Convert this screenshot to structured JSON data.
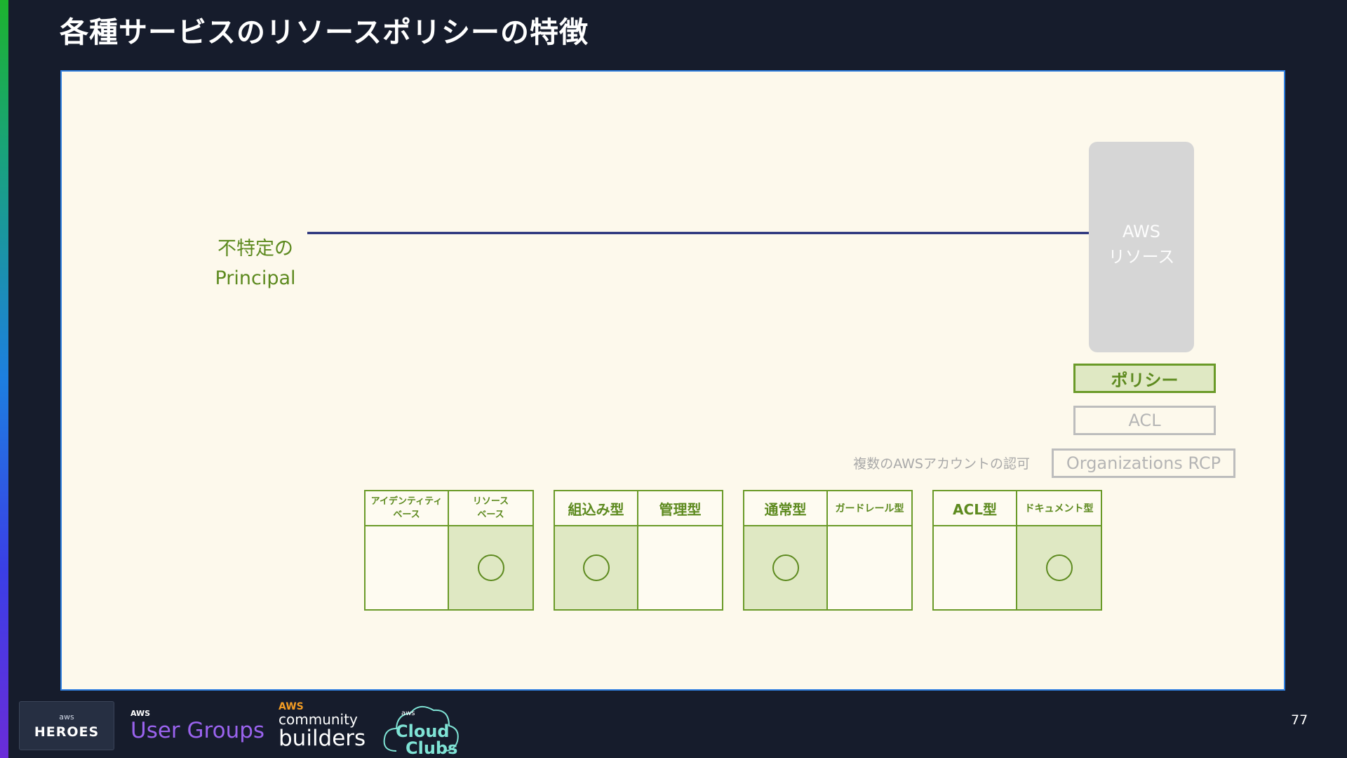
{
  "slide": {
    "title": "各種サービスのリソースポリシーの特徴",
    "page_number": "77"
  },
  "diagram": {
    "principal_line1": "不特定の",
    "principal_line2": "Principal",
    "resource_line1": "AWS",
    "resource_line2": "リソース",
    "policy_label": "ポリシー",
    "acl_label": "ACL",
    "rcp_label": "Organizations RCP",
    "rcp_note": "複数のAWSアカウントの認可"
  },
  "tables": [
    {
      "col1": "アイデンティティ\nベース",
      "col2": "リソース\nベース",
      "mark_col": 2
    },
    {
      "col1": "組込み型",
      "col2": "管理型",
      "mark_col": 1
    },
    {
      "col1": "通常型",
      "col2": "ガードレール型",
      "mark_col": 1
    },
    {
      "col1": "ACL型",
      "col2": "ドキュメント型",
      "mark_col": 2
    }
  ],
  "footer": {
    "heroes_aws": "aws",
    "heroes_word": "HEROES",
    "ug_aws": "AWS",
    "ug_word": "User Groups",
    "cb_aws": "AWS",
    "cb_community": "community",
    "cb_builders": "builders",
    "cc_aws": "aws",
    "cc_line1": "Cloud",
    "cc_line2": "Clubs"
  },
  "colors": {
    "background": "#161c2c",
    "panel": "#fdf9ec",
    "panel_border": "#2f7fe0",
    "green": "#5d8a1f",
    "green_fill": "#dfe8c3",
    "arrow": "#0f1a6e"
  }
}
